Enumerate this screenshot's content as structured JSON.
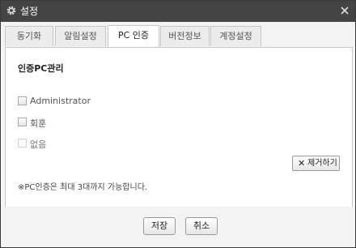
{
  "window": {
    "title": "설정"
  },
  "tabs": [
    {
      "label": "동기화"
    },
    {
      "label": "알림설정"
    },
    {
      "label": "PC 인증"
    },
    {
      "label": "버전정보"
    },
    {
      "label": "계정설정"
    }
  ],
  "active_tab": "PC 인증",
  "section": {
    "heading": "인증PC관리"
  },
  "pc_list": [
    {
      "label": "Administrator",
      "checked": false,
      "enabled": true
    },
    {
      "label": "회훈",
      "checked": false,
      "enabled": true
    },
    {
      "label": "없음",
      "checked": false,
      "enabled": false
    }
  ],
  "remove_button": {
    "icon": "x-icon",
    "label": "제거하기"
  },
  "note": "※PC인증은 최대 3대까지 가능합니다.",
  "footer": {
    "save_label": "저장",
    "cancel_label": "취소"
  },
  "colors": {
    "titlebar": "#444444",
    "border": "#c7c7c7",
    "background": "#f6f6f6"
  }
}
